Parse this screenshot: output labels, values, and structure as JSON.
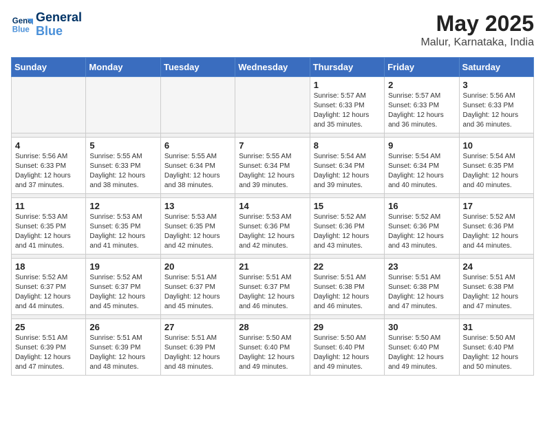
{
  "header": {
    "logo_line1": "General",
    "logo_line2": "Blue",
    "month_year": "May 2025",
    "location": "Malur, Karnataka, India"
  },
  "weekdays": [
    "Sunday",
    "Monday",
    "Tuesday",
    "Wednesday",
    "Thursday",
    "Friday",
    "Saturday"
  ],
  "weeks": [
    [
      {
        "day": "",
        "detail": ""
      },
      {
        "day": "",
        "detail": ""
      },
      {
        "day": "",
        "detail": ""
      },
      {
        "day": "",
        "detail": ""
      },
      {
        "day": "1",
        "detail": "Sunrise: 5:57 AM\nSunset: 6:33 PM\nDaylight: 12 hours\nand 35 minutes."
      },
      {
        "day": "2",
        "detail": "Sunrise: 5:57 AM\nSunset: 6:33 PM\nDaylight: 12 hours\nand 36 minutes."
      },
      {
        "day": "3",
        "detail": "Sunrise: 5:56 AM\nSunset: 6:33 PM\nDaylight: 12 hours\nand 36 minutes."
      }
    ],
    [
      {
        "day": "4",
        "detail": "Sunrise: 5:56 AM\nSunset: 6:33 PM\nDaylight: 12 hours\nand 37 minutes."
      },
      {
        "day": "5",
        "detail": "Sunrise: 5:55 AM\nSunset: 6:33 PM\nDaylight: 12 hours\nand 38 minutes."
      },
      {
        "day": "6",
        "detail": "Sunrise: 5:55 AM\nSunset: 6:34 PM\nDaylight: 12 hours\nand 38 minutes."
      },
      {
        "day": "7",
        "detail": "Sunrise: 5:55 AM\nSunset: 6:34 PM\nDaylight: 12 hours\nand 39 minutes."
      },
      {
        "day": "8",
        "detail": "Sunrise: 5:54 AM\nSunset: 6:34 PM\nDaylight: 12 hours\nand 39 minutes."
      },
      {
        "day": "9",
        "detail": "Sunrise: 5:54 AM\nSunset: 6:34 PM\nDaylight: 12 hours\nand 40 minutes."
      },
      {
        "day": "10",
        "detail": "Sunrise: 5:54 AM\nSunset: 6:35 PM\nDaylight: 12 hours\nand 40 minutes."
      }
    ],
    [
      {
        "day": "11",
        "detail": "Sunrise: 5:53 AM\nSunset: 6:35 PM\nDaylight: 12 hours\nand 41 minutes."
      },
      {
        "day": "12",
        "detail": "Sunrise: 5:53 AM\nSunset: 6:35 PM\nDaylight: 12 hours\nand 41 minutes."
      },
      {
        "day": "13",
        "detail": "Sunrise: 5:53 AM\nSunset: 6:35 PM\nDaylight: 12 hours\nand 42 minutes."
      },
      {
        "day": "14",
        "detail": "Sunrise: 5:53 AM\nSunset: 6:36 PM\nDaylight: 12 hours\nand 42 minutes."
      },
      {
        "day": "15",
        "detail": "Sunrise: 5:52 AM\nSunset: 6:36 PM\nDaylight: 12 hours\nand 43 minutes."
      },
      {
        "day": "16",
        "detail": "Sunrise: 5:52 AM\nSunset: 6:36 PM\nDaylight: 12 hours\nand 43 minutes."
      },
      {
        "day": "17",
        "detail": "Sunrise: 5:52 AM\nSunset: 6:36 PM\nDaylight: 12 hours\nand 44 minutes."
      }
    ],
    [
      {
        "day": "18",
        "detail": "Sunrise: 5:52 AM\nSunset: 6:37 PM\nDaylight: 12 hours\nand 44 minutes."
      },
      {
        "day": "19",
        "detail": "Sunrise: 5:52 AM\nSunset: 6:37 PM\nDaylight: 12 hours\nand 45 minutes."
      },
      {
        "day": "20",
        "detail": "Sunrise: 5:51 AM\nSunset: 6:37 PM\nDaylight: 12 hours\nand 45 minutes."
      },
      {
        "day": "21",
        "detail": "Sunrise: 5:51 AM\nSunset: 6:37 PM\nDaylight: 12 hours\nand 46 minutes."
      },
      {
        "day": "22",
        "detail": "Sunrise: 5:51 AM\nSunset: 6:38 PM\nDaylight: 12 hours\nand 46 minutes."
      },
      {
        "day": "23",
        "detail": "Sunrise: 5:51 AM\nSunset: 6:38 PM\nDaylight: 12 hours\nand 47 minutes."
      },
      {
        "day": "24",
        "detail": "Sunrise: 5:51 AM\nSunset: 6:38 PM\nDaylight: 12 hours\nand 47 minutes."
      }
    ],
    [
      {
        "day": "25",
        "detail": "Sunrise: 5:51 AM\nSunset: 6:39 PM\nDaylight: 12 hours\nand 47 minutes."
      },
      {
        "day": "26",
        "detail": "Sunrise: 5:51 AM\nSunset: 6:39 PM\nDaylight: 12 hours\nand 48 minutes."
      },
      {
        "day": "27",
        "detail": "Sunrise: 5:51 AM\nSunset: 6:39 PM\nDaylight: 12 hours\nand 48 minutes."
      },
      {
        "day": "28",
        "detail": "Sunrise: 5:50 AM\nSunset: 6:40 PM\nDaylight: 12 hours\nand 49 minutes."
      },
      {
        "day": "29",
        "detail": "Sunrise: 5:50 AM\nSunset: 6:40 PM\nDaylight: 12 hours\nand 49 minutes."
      },
      {
        "day": "30",
        "detail": "Sunrise: 5:50 AM\nSunset: 6:40 PM\nDaylight: 12 hours\nand 49 minutes."
      },
      {
        "day": "31",
        "detail": "Sunrise: 5:50 AM\nSunset: 6:40 PM\nDaylight: 12 hours\nand 50 minutes."
      }
    ]
  ]
}
